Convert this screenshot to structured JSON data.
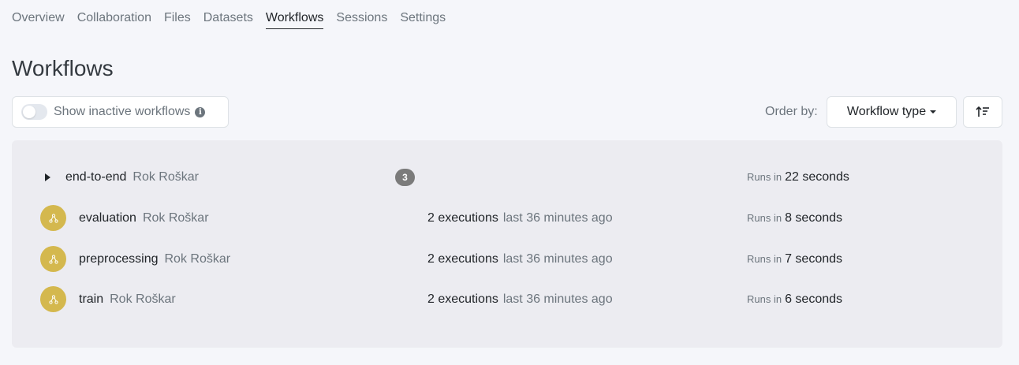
{
  "tabs": [
    {
      "label": "Overview"
    },
    {
      "label": "Collaboration"
    },
    {
      "label": "Files"
    },
    {
      "label": "Datasets"
    },
    {
      "label": "Workflows",
      "active": true
    },
    {
      "label": "Sessions"
    },
    {
      "label": "Settings"
    }
  ],
  "page_title": "Workflows",
  "toggle": {
    "label": "Show inactive workflows",
    "checked": false,
    "info_icon": "info-icon"
  },
  "order": {
    "label": "Order by:",
    "value": "Workflow type"
  },
  "colors": {
    "workflow_icon": "#d4b84e",
    "badge": "#7b7b7b",
    "panel": "#ececf1"
  },
  "workflows": [
    {
      "name": "end-to-end",
      "author": "Rok Roškar",
      "badge": "3",
      "runs_prefix": "Runs in",
      "runs_value": "22 seconds"
    },
    {
      "name": "evaluation",
      "author": "Rok Roškar",
      "executions": "2 executions",
      "last": "last 36 minutes ago",
      "runs_prefix": "Runs in",
      "runs_value": "8 seconds"
    },
    {
      "name": "preprocessing",
      "author": "Rok Roškar",
      "executions": "2 executions",
      "last": "last 36 minutes ago",
      "runs_prefix": "Runs in",
      "runs_value": "7 seconds"
    },
    {
      "name": "train",
      "author": "Rok Roškar",
      "executions": "2 executions",
      "last": "last 36 minutes ago",
      "runs_prefix": "Runs in",
      "runs_value": "6 seconds"
    }
  ]
}
